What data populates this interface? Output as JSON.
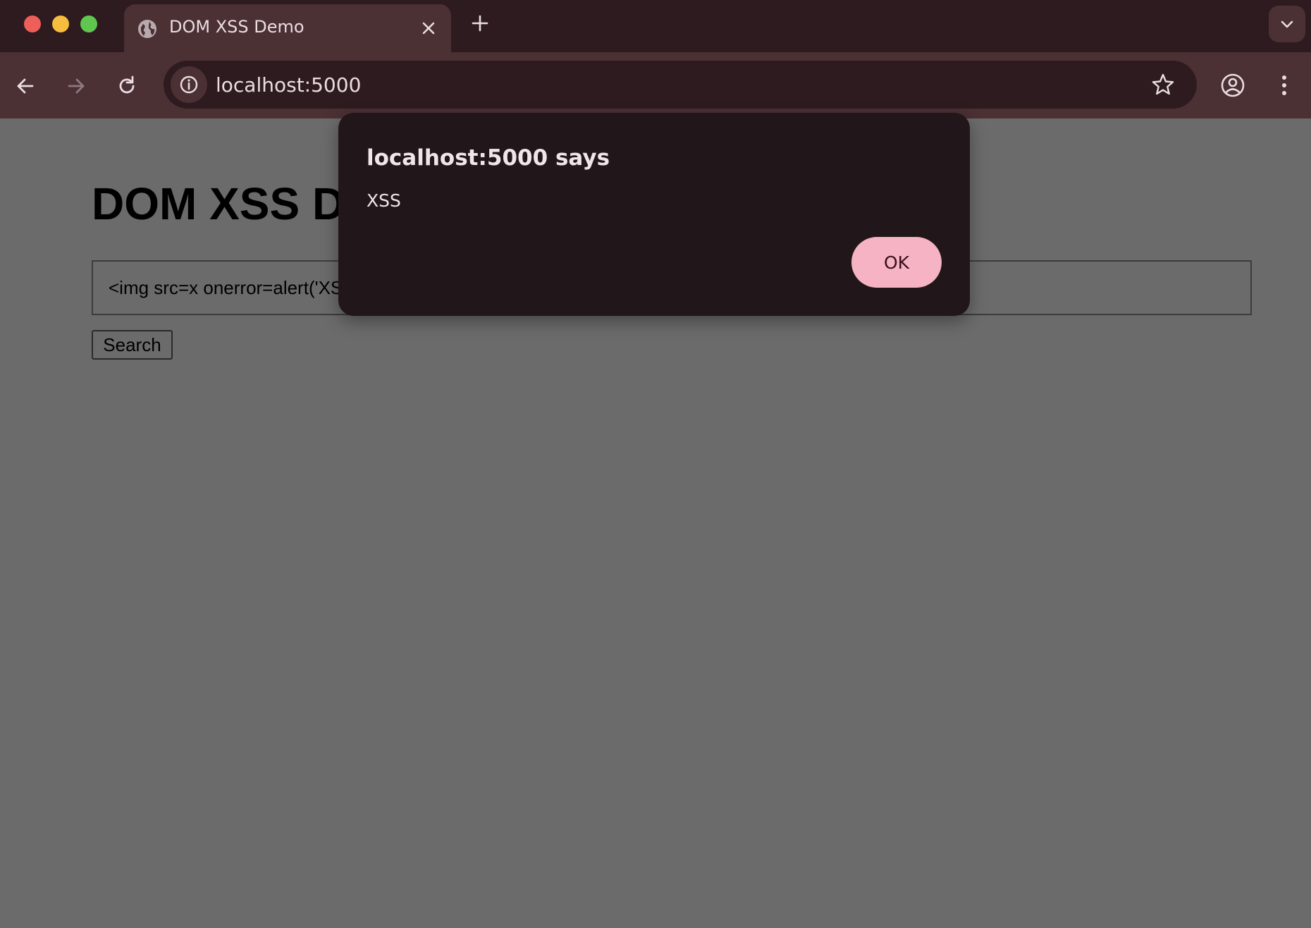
{
  "browser": {
    "tab": {
      "title": "DOM XSS Demo"
    },
    "address_bar": {
      "url": "localhost:5000"
    }
  },
  "page": {
    "title": "DOM XSS Demo",
    "search_input_value": "<img src=x onerror=alert('XSS')>",
    "search_button_label": "Search"
  },
  "dialog": {
    "title": "localhost:5000 says",
    "message": "XSS",
    "ok_label": "OK"
  },
  "colors": {
    "tabbar_bg": "#2e1b20",
    "toolbar_bg": "#4b3034",
    "page_overlay": "#6b6b6b",
    "dialog_bg": "#211619",
    "ok_button": "#f5b3c3"
  }
}
